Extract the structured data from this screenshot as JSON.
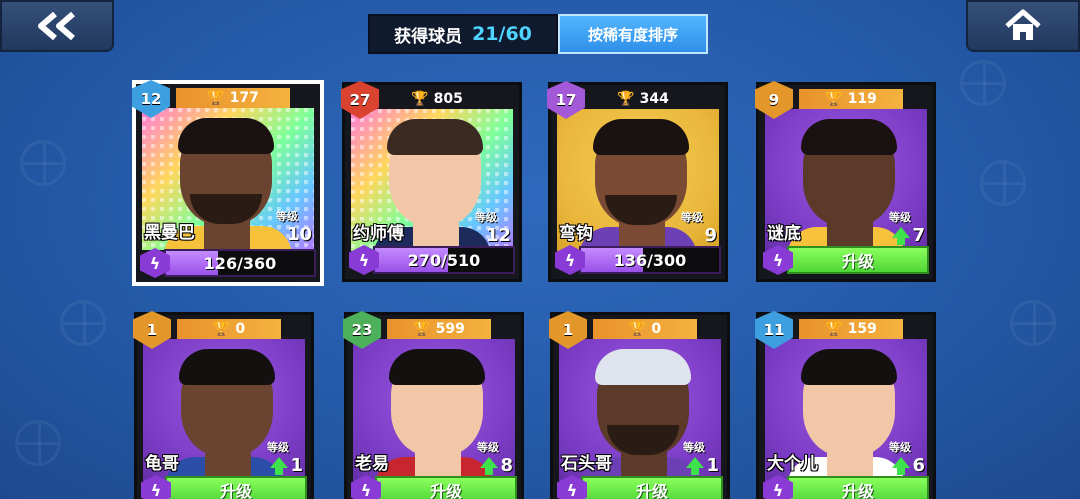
{
  "header": {
    "collected_label": "获得球员",
    "collected_value": "21/60",
    "sort_label": "按稀有度排序"
  },
  "icons": {
    "back": "double-chevron-left-icon",
    "home": "home-icon",
    "trophy": "trophy-icon",
    "energy": "lightning-icon"
  },
  "level_label": "等级",
  "upgrade_label": "升级",
  "cards": [
    {
      "rank": "12",
      "trophies": "177",
      "name": "黑曼巴",
      "level": "10",
      "progress_text": "126/360",
      "progress": 0.35,
      "bg": "holo",
      "rank_color": "rank-blue",
      "can_upgrade": false,
      "selected": true
    },
    {
      "rank": "27",
      "trophies": "805",
      "name": "约师傅",
      "level": "12",
      "progress_text": "270/510",
      "progress": 0.53,
      "bg": "holo",
      "rank_color": "rank-red",
      "can_upgrade": false,
      "selected": false
    },
    {
      "rank": "17",
      "trophies": "344",
      "name": "弯钩",
      "level": "9",
      "progress_text": "136/300",
      "progress": 0.45,
      "bg": "gold",
      "rank_color": "rank-purple",
      "can_upgrade": false,
      "selected": false
    },
    {
      "rank": "9",
      "trophies": "119",
      "name": "谜底",
      "level": "7",
      "progress_text": "",
      "progress": 1,
      "bg": "purple",
      "rank_color": "rank-orange",
      "can_upgrade": true,
      "selected": false
    },
    {
      "rank": "1",
      "trophies": "0",
      "name": "龟哥",
      "level": "1",
      "progress_text": "",
      "progress": 1,
      "bg": "purple",
      "rank_color": "rank-orange",
      "can_upgrade": true,
      "selected": false
    },
    {
      "rank": "23",
      "trophies": "599",
      "name": "老易",
      "level": "8",
      "progress_text": "",
      "progress": 1,
      "bg": "purple",
      "rank_color": "rank-green",
      "can_upgrade": true,
      "selected": false
    },
    {
      "rank": "1",
      "trophies": "0",
      "name": "石头哥",
      "level": "1",
      "progress_text": "",
      "progress": 1,
      "bg": "purple",
      "rank_color": "rank-orange",
      "can_upgrade": true,
      "selected": false
    },
    {
      "rank": "11",
      "trophies": "159",
      "name": "大个儿",
      "level": "6",
      "progress_text": "",
      "progress": 1,
      "bg": "purple",
      "rank_color": "rank-blue",
      "can_upgrade": true,
      "selected": false
    }
  ]
}
